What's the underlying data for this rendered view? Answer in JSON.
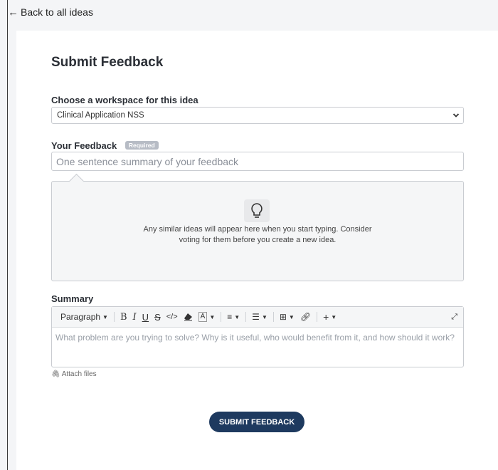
{
  "nav": {
    "back_label": "Back to all ideas"
  },
  "form": {
    "title": "Submit Feedback",
    "workspace": {
      "label": "Choose a workspace for this idea",
      "selected": "Clinical Application NSS"
    },
    "feedback": {
      "label": "Your Feedback",
      "required_badge": "Required",
      "placeholder": "One sentence summary of your feedback"
    },
    "similar": {
      "line1": "Any similar ideas will appear here when you start typing. Consider",
      "line2": "voting for them before you create a new idea."
    },
    "summary": {
      "label": "Summary",
      "paragraph_label": "Paragraph",
      "placeholder": "What problem are you trying to solve?  Why is it useful, who would benefit from it, and how should it work?"
    },
    "attach_label": "Attach files",
    "submit_label": "SUBMIT FEEDBACK"
  },
  "icons": {
    "back": "arrow-left-icon",
    "chevron": "chevron-down-icon",
    "bulb": "lightbulb-icon",
    "bold": "bold-icon",
    "italic": "italic-icon",
    "underline": "underline-icon",
    "strike": "strikethrough-icon",
    "code": "code-icon",
    "eraser": "clear-format-icon",
    "text_color": "text-color-icon",
    "align": "align-icon",
    "list": "list-icon",
    "table": "table-icon",
    "link": "link-icon",
    "insert": "plus-icon",
    "expand": "expand-icon",
    "attach": "paperclip-icon"
  },
  "colors": {
    "primary": "#1e3a5f",
    "page_bg": "#f4f5f7",
    "badge": "#b7bcc5"
  }
}
